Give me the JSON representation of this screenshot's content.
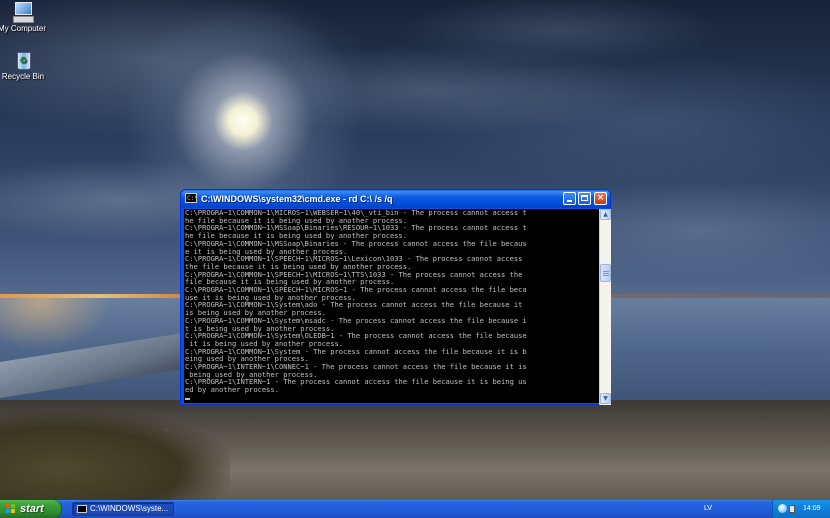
{
  "desktop": {
    "icons": [
      {
        "label": "My Computer",
        "icon": "my-computer-icon"
      },
      {
        "label": "Recycle Bin",
        "icon": "recycle-bin-icon"
      }
    ]
  },
  "cmd_window": {
    "title": "C:\\WINDOWS\\system32\\cmd.exe - rd C:\\ /s /q",
    "icon": "cmd-icon",
    "buttons": {
      "minimize": "minimize-icon",
      "maximize": "maximize-icon",
      "close": "×"
    },
    "lines": [
      "C:\\PROGRA~1\\COMMON~1\\MICROS~1\\WEBSER~1\\40\\_vti_bin - The process cannot access t",
      "he file because it is being used by another process.",
      "C:\\PROGRA~1\\COMMON~1\\MSSoap\\Binaries\\RESOUR~1\\1033 - The process cannot access t",
      "he file because it is being used by another process.",
      "C:\\PROGRA~1\\COMMON~1\\MSSoap\\Binaries - The process cannot access the file becaus",
      "e it is being used by another process.",
      "C:\\PROGRA~1\\COMMON~1\\SPEECH~1\\MICROS~1\\Lexicon\\1033 - The process cannot access",
      "the file because it is being used by another process.",
      "C:\\PROGRA~1\\COMMON~1\\SPEECH~1\\MICROS~1\\TTS\\1033 - The process cannot access the",
      "file because it is being used by another process.",
      "C:\\PROGRA~1\\COMMON~1\\SPEECH~1\\MICROS~1 - The process cannot access the file beca",
      "use it is being used by another process.",
      "C:\\PROGRA~1\\COMMON~1\\System\\ado - The process cannot access the file because it",
      "is being used by another process.",
      "C:\\PROGRA~1\\COMMON~1\\System\\msadc - The process cannot access the file because i",
      "t is being used by another process.",
      "C:\\PROGRA~1\\COMMON~1\\System\\OLEDB~1 - The process cannot access the file because",
      " it is being used by another process.",
      "C:\\PROGRA~1\\COMMON~1\\System - The process cannot access the file because it is b",
      "eing used by another process.",
      "C:\\PROGRA~1\\INTERN~1\\CONNEC~1 - The process cannot access the file because it is",
      " being used by another process.",
      "C:\\PROGRA~1\\INTERN~1 - The process cannot access the file because it is being us",
      "ed by another process."
    ],
    "colors": {
      "console_bg": "#000000",
      "console_text": "#c0c0c0",
      "titlebar": "#0054e3"
    }
  },
  "taskbar": {
    "start_label": "start",
    "task_button_label": "C:\\WINDOWS\\syste...",
    "language": "LV",
    "clock": "14:09"
  }
}
